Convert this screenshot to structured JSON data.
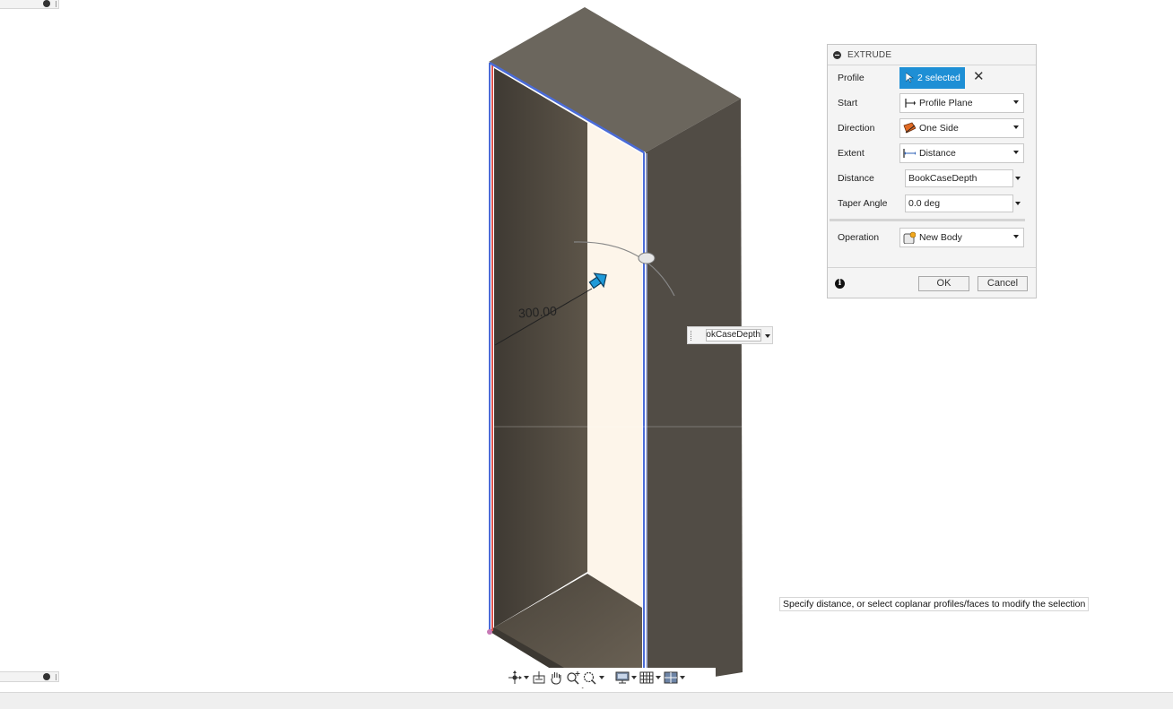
{
  "dialog": {
    "title": "EXTRUDE",
    "profile": {
      "label": "Profile",
      "selection": "2 selected"
    },
    "start": {
      "label": "Start",
      "value": "Profile Plane"
    },
    "direction": {
      "label": "Direction",
      "value": "One Side"
    },
    "extent": {
      "label": "Extent",
      "value": "Distance"
    },
    "distance": {
      "label": "Distance",
      "value": "BookCaseDepth"
    },
    "taper": {
      "label": "Taper Angle",
      "value": "0.0 deg"
    },
    "operation": {
      "label": "Operation",
      "value": "New Body"
    },
    "ok_label": "OK",
    "cancel_label": "Cancel"
  },
  "viewport": {
    "dimension_label": "300.00",
    "floating_input_value": "BookCaseDepth",
    "tooltip": "Specify distance, or select coplanar profiles/faces to modify the selection"
  },
  "colors": {
    "accent": "#1e8fd5",
    "body_dark": "#4f4a42",
    "body_top": "#6c665d",
    "interior": "#fdf5ea",
    "edge_blue": "#4a6bd8",
    "edge_red": "#e0534f"
  }
}
